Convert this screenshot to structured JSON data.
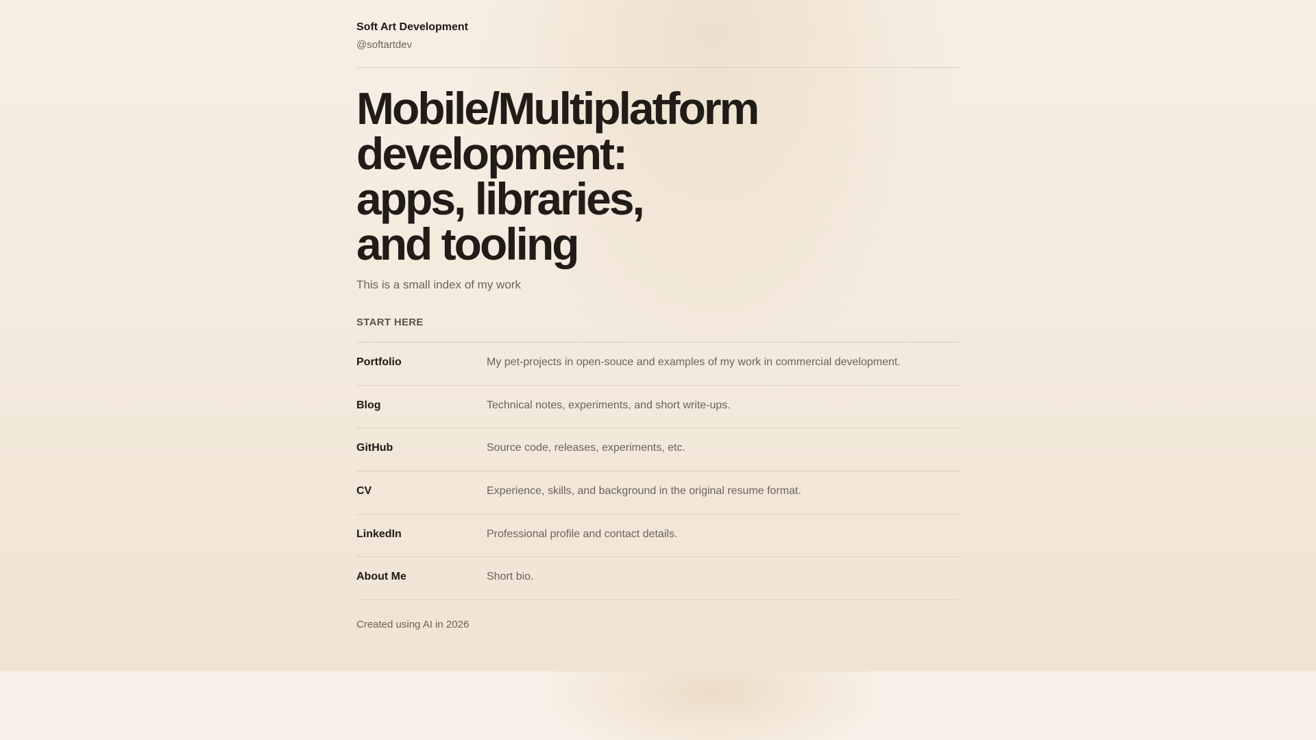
{
  "header": {
    "site_name": "Soft Art Development",
    "handle": "@softartdev"
  },
  "hero": {
    "headline_lines": [
      "Mobile/Multiplatform",
      "development:",
      "apps, libraries,",
      "and tooling"
    ],
    "subtitle": "This is a small index of my work"
  },
  "links_section": {
    "label": "START HERE",
    "items": [
      {
        "title": "Portfolio",
        "description": "My pet-projects in open-souce and examples of my work in commercial development."
      },
      {
        "title": "Blog",
        "description": "Technical notes, experiments, and short write-ups."
      },
      {
        "title": "GitHub",
        "description": "Source code, releases, experiments, etc."
      },
      {
        "title": "CV",
        "description": "Experience, skills, and background in the original resume format."
      },
      {
        "title": "LinkedIn",
        "description": "Professional profile and contact details."
      },
      {
        "title": "About Me",
        "description": "Short bio."
      }
    ]
  },
  "footer": {
    "note": "Created using AI in 2026"
  },
  "colors": {
    "background": "#f7f0e6",
    "text_primary": "#1f1a16",
    "text_secondary": "#6b635b",
    "divider": "#d9d0c4"
  }
}
